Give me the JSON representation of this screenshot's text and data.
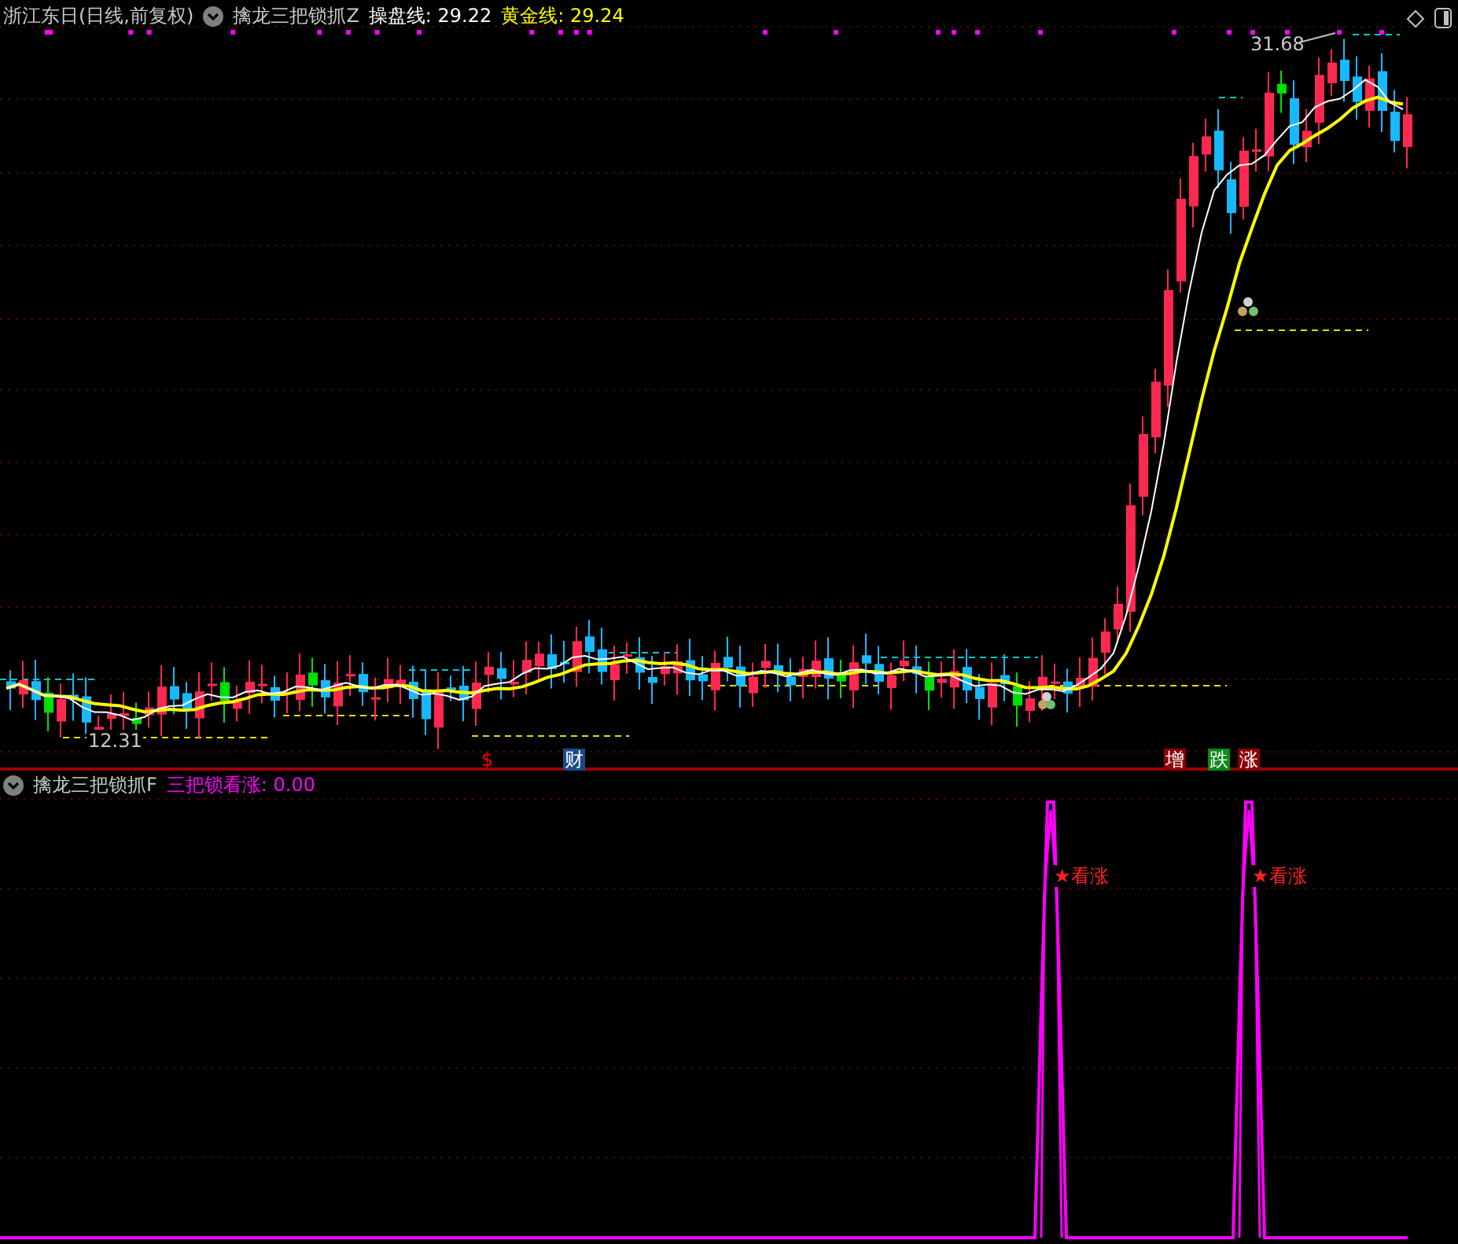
{
  "main_panel": {
    "stock": "浙江东日(日线,前复权)",
    "indicator": "擒龙三把锁抓Z",
    "lines": [
      {
        "label": "操盘线:",
        "value": "29.22",
        "color": "#ffffff"
      },
      {
        "label": "黄金线:",
        "value": "29.24",
        "color": "#ffff00"
      }
    ],
    "high_label": "31.68",
    "low_label": "12.31",
    "markers": [
      {
        "text": "$",
        "kind": "plain",
        "color": "#ff0000"
      },
      {
        "text": "财",
        "kind": "badge",
        "color": "#1a4a8a"
      },
      {
        "text": "增",
        "kind": "badge",
        "color": "#8b0000"
      },
      {
        "text": "跌",
        "kind": "badge",
        "color": "#0a8a1a"
      },
      {
        "text": "涨",
        "kind": "badge",
        "color": "#8b0000"
      }
    ]
  },
  "sub_panel": {
    "indicator": "擒龙三把锁抓F",
    "lines": [
      {
        "label": "三把锁看涨:",
        "value": "0.00",
        "color": "#ff00ff"
      }
    ],
    "signals": [
      {
        "text": "★看涨"
      },
      {
        "text": "★看涨"
      }
    ]
  }
}
